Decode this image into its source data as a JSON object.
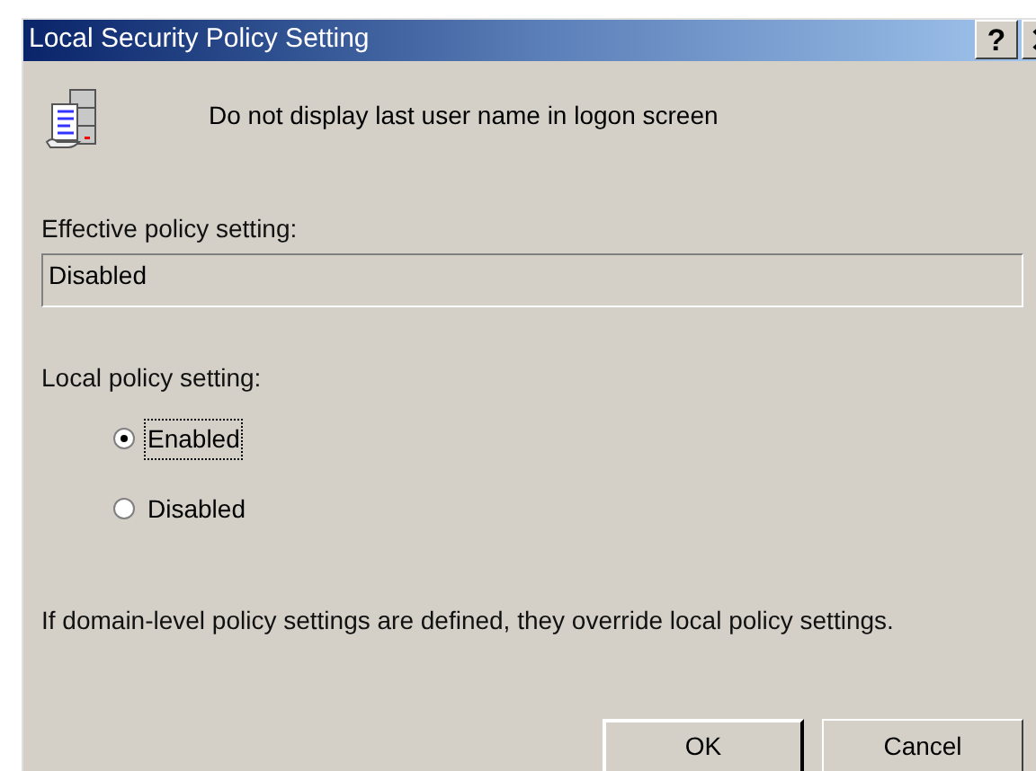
{
  "window": {
    "title": "Local Security Policy Setting",
    "help_button": "?"
  },
  "policy_name": "Do not display last user name in logon screen",
  "effective_setting": {
    "label": "Effective policy setting:",
    "value": "Disabled"
  },
  "local_setting": {
    "label": "Local policy setting:",
    "options": [
      {
        "label": "Enabled",
        "selected": true,
        "focused": true
      },
      {
        "label": "Disabled",
        "selected": false,
        "focused": false
      }
    ]
  },
  "note": "If domain-level policy settings are defined, they override local policy settings.",
  "buttons": [
    {
      "label": "OK",
      "default": true
    },
    {
      "label": "Cancel",
      "default": false
    }
  ]
}
